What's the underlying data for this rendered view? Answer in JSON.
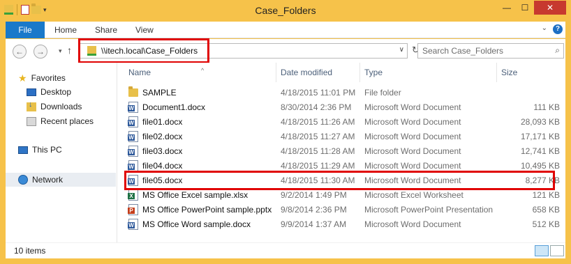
{
  "window": {
    "title": "Case_Folders"
  },
  "ribbon": {
    "tabs": [
      "File",
      "Home",
      "Share",
      "View"
    ]
  },
  "address": {
    "path": "\\\\itech.local\\Case_Folders",
    "search_placeholder": "Search Case_Folders"
  },
  "nav_pane": {
    "favorites": "Favorites",
    "favorite_items": [
      "Desktop",
      "Downloads",
      "Recent places"
    ],
    "this_pc": "This PC",
    "network": "Network"
  },
  "columns": {
    "name": "Name",
    "date": "Date modified",
    "type": "Type",
    "size": "Size"
  },
  "files": [
    {
      "icon": "folder",
      "name": "SAMPLE",
      "date": "4/18/2015 11:01 PM",
      "type": "File folder",
      "size": ""
    },
    {
      "icon": "word",
      "name": "Document1.docx",
      "date": "8/30/2014 2:36 PM",
      "type": "Microsoft Word Document",
      "size": "111 KB"
    },
    {
      "icon": "word",
      "name": "file01.docx",
      "date": "4/18/2015 11:26 AM",
      "type": "Microsoft Word Document",
      "size": "28,093 KB"
    },
    {
      "icon": "word",
      "name": "file02.docx",
      "date": "4/18/2015 11:27 AM",
      "type": "Microsoft Word Document",
      "size": "17,171 KB"
    },
    {
      "icon": "word",
      "name": "file03.docx",
      "date": "4/18/2015 11:28 AM",
      "type": "Microsoft Word Document",
      "size": "12,741 KB"
    },
    {
      "icon": "word",
      "name": "file04.docx",
      "date": "4/18/2015 11:29 AM",
      "type": "Microsoft Word Document",
      "size": "10,495 KB"
    },
    {
      "icon": "word",
      "name": "file05.docx",
      "date": "4/18/2015 11:30 AM",
      "type": "Microsoft Word Document",
      "size": "8,277 KB"
    },
    {
      "icon": "excel",
      "name": "MS Office Excel sample.xlsx",
      "date": "9/2/2014 1:49 PM",
      "type": "Microsoft Excel Worksheet",
      "size": "121 KB"
    },
    {
      "icon": "powerpoint",
      "name": "MS Office PowerPoint sample.pptx",
      "date": "9/8/2014 2:36 PM",
      "type": "Microsoft PowerPoint Presentation",
      "size": "658 KB"
    },
    {
      "icon": "word",
      "name": "MS Office Word sample.docx",
      "date": "9/9/2014 1:37 AM",
      "type": "Microsoft Word Document",
      "size": "512 KB"
    }
  ],
  "status": {
    "item_count": "10 items"
  },
  "colors": {
    "accent": "#1979ca",
    "window_frame": "#f6c24a",
    "highlight_box": "#e00000"
  }
}
